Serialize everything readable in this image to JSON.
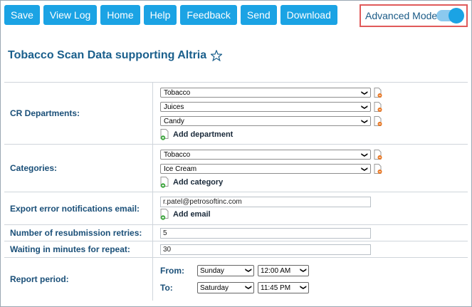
{
  "toolbar": {
    "buttons": [
      "Save",
      "View Log",
      "Home",
      "Help",
      "Feedback",
      "Send",
      "Download"
    ]
  },
  "advanced_mode": {
    "label": "Advanced Mode",
    "enabled": true
  },
  "page": {
    "title": "Tobacco Scan Data supporting Altria"
  },
  "form": {
    "cr_departments": {
      "label": "CR Departments:",
      "values": [
        "Tobacco",
        "Juices",
        "Candy"
      ],
      "add_label": "Add department"
    },
    "categories": {
      "label": "Categories:",
      "values": [
        "Tobacco",
        "Ice Cream"
      ],
      "add_label": "Add category"
    },
    "export_email": {
      "label": "Export error notifications email:",
      "value": "r.patel@petrosoftinc.com",
      "add_label": "Add email"
    },
    "resubmission": {
      "label": "Number of resubmission retries:",
      "value": "5"
    },
    "waiting": {
      "label": "Waiting in minutes for repeat:",
      "value": "30"
    },
    "report_period": {
      "label": "Report period:",
      "from_label": "From:",
      "from_day": "Sunday",
      "from_time": "12:00 AM",
      "to_label": "To:",
      "to_day": "Saturday",
      "to_time": "11:45 PM"
    }
  },
  "colors": {
    "button_bg": "#1ba3e4",
    "label_text": "#1a4f78",
    "highlight_border": "#e05a5a"
  }
}
